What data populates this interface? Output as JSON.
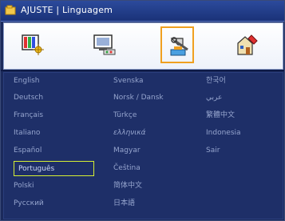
{
  "header": {
    "title": "AJUSTE | Linguagem"
  },
  "tabs": [
    {
      "icon": "image-settings-icon",
      "selected": false
    },
    {
      "icon": "display-settings-icon",
      "selected": false
    },
    {
      "icon": "setup-settings-icon",
      "selected": true
    },
    {
      "icon": "options-settings-icon",
      "selected": false
    }
  ],
  "languages": {
    "col1": [
      "English",
      "Deutsch",
      "Français",
      "Italiano",
      "Español",
      "Português",
      "Polski",
      "Русский"
    ],
    "col2": [
      "Svenska",
      "Norsk / Dansk",
      "Türkçe",
      "ελληνικά",
      "Magyar",
      "Čeština",
      "简体中文",
      "日本語"
    ],
    "col3": [
      "한국어",
      "عربي",
      "繁體中文",
      "Indonesia",
      "Sair"
    ]
  },
  "selected_language": "Português",
  "colors": {
    "highlight": "#d6ee33",
    "selected_tab": "#f0a020",
    "title_bar": "#2c4a9c"
  }
}
